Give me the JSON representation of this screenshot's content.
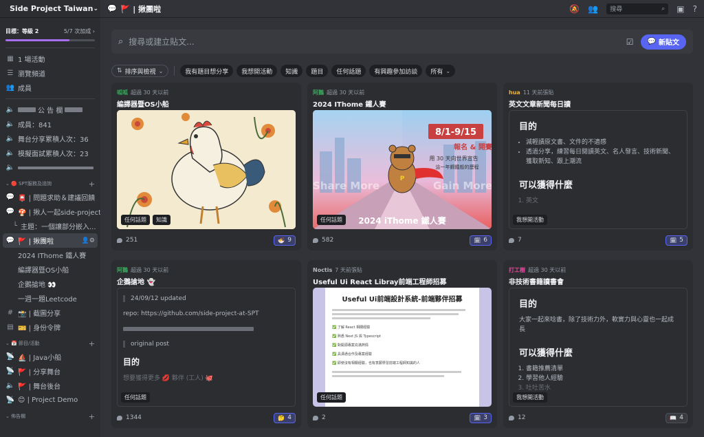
{
  "server": {
    "name": "Side Project Taiwan"
  },
  "goal": {
    "label": "目標：等級 2",
    "progress_text": "5/7 次加成",
    "progress_fraction": 0.714
  },
  "sidebar": {
    "top_items": [
      {
        "icon": "calendar-icon",
        "label": "1 場活動"
      },
      {
        "icon": "browse-icon",
        "label": "瀏覽頻道"
      },
      {
        "icon": "members-icon",
        "label": "成員"
      }
    ],
    "stats": [
      {
        "label": "公 告 欄"
      },
      {
        "label": "成員：841"
      },
      {
        "label": "舞台分享累積人次：36"
      },
      {
        "label": "模擬面試累積人次：23"
      }
    ],
    "cat_spt": "SPT服務及諮詢",
    "spt_items": [
      {
        "label": "問題求助＆建議回饋"
      },
      {
        "label": "揪人一起side-project"
      },
      {
        "label": "主題：一個讓部分嵌入..."
      },
      {
        "label": "揪團啦"
      }
    ],
    "threads": [
      "2024 IThome 鐵人賽",
      "編譯器暨OS小船",
      "企鵝搶地",
      "一週一題Leetcode"
    ],
    "more_items": [
      {
        "label": "截圖分享"
      },
      {
        "label": "身份令牌"
      }
    ],
    "cat_events": "節目/活動",
    "event_items": [
      {
        "label": "Java小船"
      },
      {
        "label": "分享舞台"
      },
      {
        "label": "舞台後台"
      },
      {
        "label": "Project Demo"
      }
    ],
    "cat_board": "佈告欄"
  },
  "topbar": {
    "channel": "揪團啦",
    "search_placeholder": "搜尋"
  },
  "composer": {
    "placeholder": "搜尋或建立貼文...",
    "new_post": "新貼文"
  },
  "filters": {
    "sort": "排序與檢視",
    "tags": [
      "我有題目想分享",
      "我想開活動",
      "知識",
      "題目",
      "任何話題",
      "有興趣參加訪談"
    ],
    "all": "所有"
  },
  "cards": [
    {
      "author": "呱呱",
      "author_color": "#3ba55c",
      "time": "超過 30 天以前",
      "title": "編譯器暨OS小船",
      "tags": [
        "任何話題",
        "知識"
      ],
      "count": "251",
      "reaction": "9"
    },
    {
      "author": "阿鵝",
      "author_color": "#3ba55c",
      "time": "超過 30 天以前",
      "title": "2024 IThome 鐵人賽",
      "tags": [
        "任何話題"
      ],
      "count": "582",
      "reaction": "6",
      "img_dates": "8/1-9/15",
      "img_tag": "報名 & 開賽",
      "img_line1": "用 30 天向世界宣告",
      "img_line2": "這一年鋼鐵般的歷程",
      "img_share": "Share More",
      "img_gain": "Gain More",
      "img_title": "2024 iThome 鐵人賽"
    },
    {
      "author": "hua",
      "author_color": "#f0b232",
      "time": "11 天前張貼",
      "title": "英文文章新聞每日讀",
      "tags": [
        "我想開活動"
      ],
      "count": "7",
      "reaction": "5",
      "h1": "目的",
      "bullets": [
        "減輕讀原文書、文件的不適感",
        "透過分享，練習每日閱讀英文、名人發言、技術新聞、獲取新知、跟上潮流"
      ],
      "h2": "可以獲得什麼",
      "ol": [
        "英文"
      ]
    },
    {
      "author": "阿鵝",
      "author_color": "#3ba55c",
      "time": "超過 30 天以前",
      "title": "企鵝搶地 👻",
      "tags": [
        "任何話題"
      ],
      "count": "1344",
      "reaction": "4",
      "quote1": "24/09/12 updated",
      "repo": "repo: https://github.com/side-project-at-SPT",
      "quote2": "original post",
      "h1": "目的",
      "fade": "想要獲得更多 💋 夥伴 (工人) 🐙"
    },
    {
      "author": "Noctis",
      "author_color": "#b5bac1",
      "time": "7 天前張貼",
      "title": "Useful Ui React Libray前端工程師招募",
      "tags": [
        "任何話題"
      ],
      "count": "2",
      "reaction": "3",
      "doc_title": "Useful Ui前端設計系統-前端夥伴招募",
      "doc_checks": [
        "了解 React 相關經驗",
        "熟悉 Next JS 與 Typescript",
        "對開源專案充滿熱情",
        "具溝通合作及專案經驗",
        "即使沒有相關經驗，也有意願學習前端工程師知識的人"
      ]
    },
    {
      "author": "打工樹",
      "author_color": "#eb459e",
      "time": "超過 30 天以前",
      "title": "非技術書籍讀書會",
      "tags": [
        "我想開活動"
      ],
      "count": "12",
      "reaction": "4",
      "h1": "目的",
      "p": "大家一起來唸書，除了技術力外，軟實力與心靈也一起成長",
      "h2": "可以獲得什麼",
      "ol": [
        "書籍推薦清單",
        "學習他人經驗",
        "吐吐苦水"
      ]
    }
  ],
  "colors": {
    "accent": "#5865f2",
    "bg": "#313338",
    "sidebar": "#2b2d31",
    "progress": "#a86ef0"
  }
}
